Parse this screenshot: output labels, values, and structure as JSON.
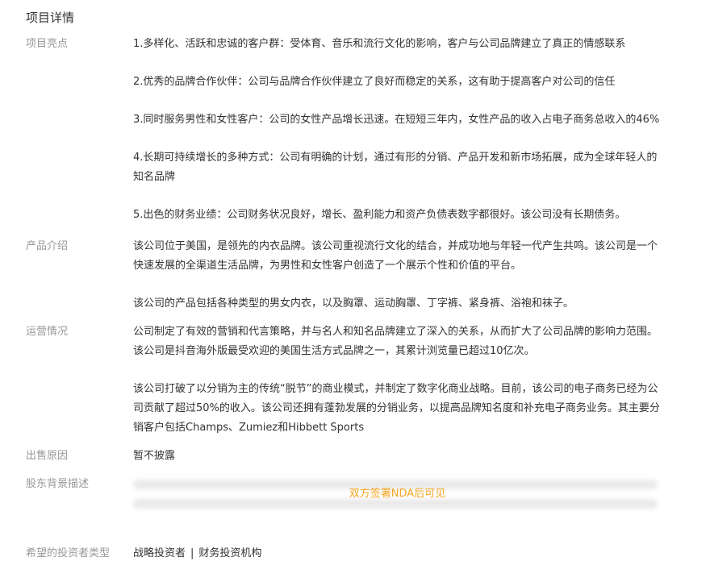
{
  "section_title": "项目详情",
  "highlights": {
    "label": "项目亮点",
    "items": [
      "1.多样化、活跃和忠诚的客户群：受体育、音乐和流行文化的影响，客户与公司品牌建立了真正的情感联系",
      "2.优秀的品牌合作伙伴：公司与品牌合作伙伴建立了良好而稳定的关系，这有助于提高客户对公司的信任",
      "3.同时服务男性和女性客户：公司的女性产品增长迅速。在短短三年内，女性产品的收入占电子商务总收入的46%",
      "4.长期可持续增长的多种方式：公司有明确的计划，通过有形的分销、产品开发和新市场拓展，成为全球年轻人的知名品牌",
      "5.出色的财务业绩：公司财务状况良好，增长、盈利能力和资产负债表数字都很好。该公司没有长期债务。"
    ]
  },
  "product": {
    "label": "产品介绍",
    "paragraphs": [
      "该公司位于美国，是领先的内衣品牌。该公司重视流行文化的结合，并成功地与年轻一代产生共鸣。该公司是一个快速发展的全渠道生活品牌，为男性和女性客户创造了一个展示个性和价值的平台。",
      "该公司的产品包括各种类型的男女内衣，以及胸罩、运动胸罩、丁字裤、紧身裤、浴袍和袜子。"
    ]
  },
  "operations": {
    "label": "运营情况",
    "paragraphs": [
      "公司制定了有效的营销和代言策略，并与名人和知名品牌建立了深入的关系，从而扩大了公司品牌的影响力范围。该公司是抖音海外版最受欢迎的美国生活方式品牌之一，其累计浏览量已超过10亿次。",
      "该公司打破了以分销为主的传统“脱节”的商业模式，并制定了数字化商业战略。目前，该公司的电子商务已经为公司贡献了超过50%的收入。该公司还拥有蓬勃发展的分销业务，以提高品牌知名度和补充电子商务业务。其主要分销客户包括Champs、Zumiez和Hibbett Sports"
    ]
  },
  "sale_reason": {
    "label": "出售原因",
    "value": "暂不披露"
  },
  "shareholders": {
    "label": "股东背景描述",
    "nda_note": "双方签署NDA后可见"
  },
  "investor_type": {
    "label": "希望的投资者类型",
    "options": [
      "战略投资者",
      "财务投资机构"
    ],
    "separator": "|"
  },
  "colors": {
    "label": "#999999",
    "text": "#333333",
    "nda": "#f5a623"
  }
}
